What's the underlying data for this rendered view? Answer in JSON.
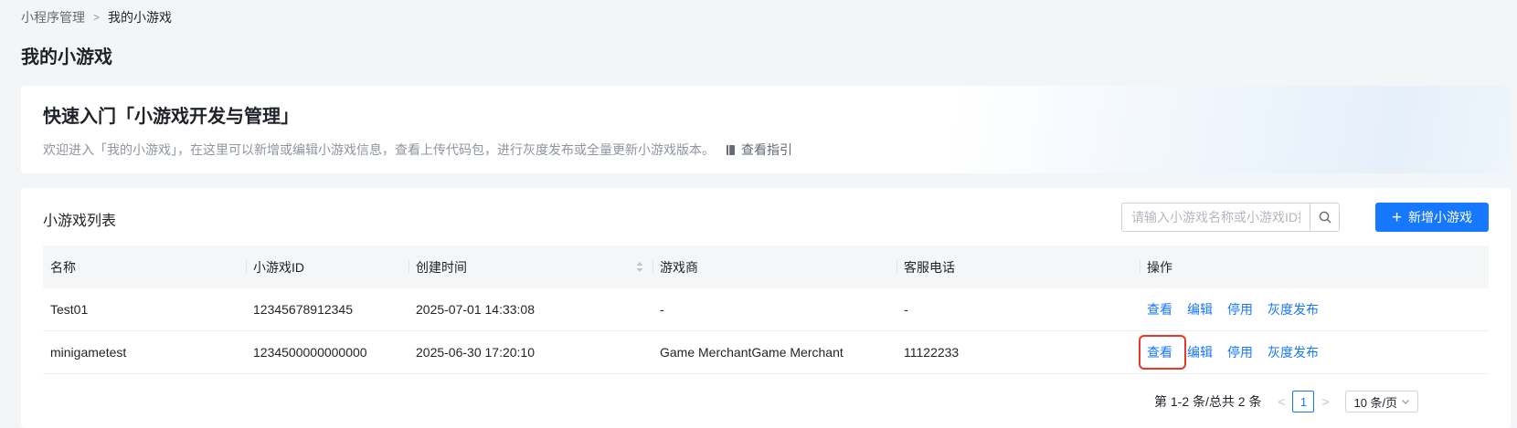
{
  "breadcrumb": {
    "parent": "小程序管理",
    "separator": ">",
    "current": "我的小游戏"
  },
  "page_title": "我的小游戏",
  "banner": {
    "title": "快速入门「小游戏开发与管理」",
    "description": "欢迎进入「我的小游戏」，在这里可以新增或编辑小游戏信息，查看上传代码包，进行灰度发布或全量更新小游戏版本。",
    "guide_link": "查看指引",
    "guide_icon": "book-icon"
  },
  "list": {
    "title": "小游戏列表",
    "search_placeholder": "请输入小游戏名称或小游戏ID搜索",
    "search_icon": "search-icon",
    "add_button": "新增小游戏",
    "add_icon": "plus-icon"
  },
  "table": {
    "headers": [
      "名称",
      "小游戏ID",
      "创建时间",
      "游戏商",
      "客服电话",
      "操作"
    ],
    "sortable_column": "创建时间",
    "rows": [
      {
        "name": "Test01",
        "id": "12345678912345",
        "created": "2025-07-01 14:33:08",
        "merchant": "-",
        "phone": "-",
        "actions": [
          "查看",
          "编辑",
          "停用",
          "灰度发布"
        ]
      },
      {
        "name": "minigametest",
        "id": "1234500000000000",
        "created": "2025-06-30 17:20:10",
        "merchant": "Game MerchantGame Merchant",
        "phone": "11122233",
        "actions": [
          "查看",
          "编辑",
          "停用",
          "灰度发布"
        ]
      }
    ]
  },
  "pagination": {
    "summary": "第 1-2 条/总共 2 条",
    "prev": "<",
    "current_page": "1",
    "next": ">",
    "page_size": "10 条/页"
  },
  "colors": {
    "primary": "#1677ff",
    "highlight": "#e5382b",
    "page_bg": "#f4f5f7"
  }
}
